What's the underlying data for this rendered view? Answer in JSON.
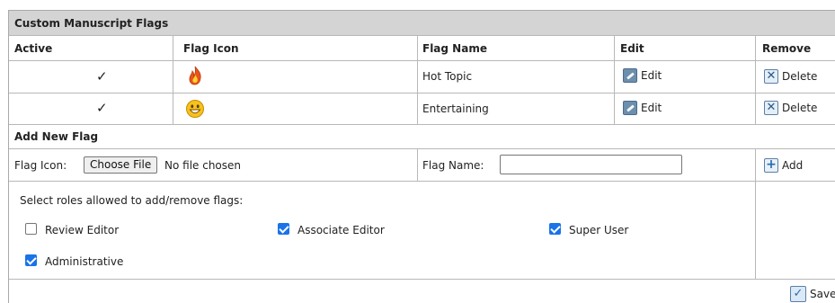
{
  "panel": {
    "title": "Custom Manuscript Flags"
  },
  "table": {
    "headers": {
      "active": "Active",
      "flag_icon": "Flag Icon",
      "flag_name": "Flag Name",
      "edit": "Edit",
      "remove": "Remove"
    },
    "rows": [
      {
        "active": "✓",
        "icon": "fire-icon",
        "name": "Hot Topic",
        "edit": "Edit",
        "remove": "Delete"
      },
      {
        "active": "✓",
        "icon": "smiley-icon",
        "name": "Entertaining",
        "edit": "Edit",
        "remove": "Delete"
      }
    ]
  },
  "add_section": {
    "title": "Add New Flag",
    "icon_label": "Flag Icon:",
    "choose_file": "Choose File",
    "no_file": "No file chosen",
    "name_label": "Flag Name:",
    "name_value": "",
    "add": "Add"
  },
  "roles": {
    "prompt": "Select roles allowed to add/remove flags:",
    "items": [
      {
        "label": "Review Editor",
        "checked": false
      },
      {
        "label": "Associate Editor",
        "checked": true
      },
      {
        "label": "Super User",
        "checked": true
      },
      {
        "label": "Administrative",
        "checked": true
      }
    ]
  },
  "footer": {
    "save": "Save"
  }
}
